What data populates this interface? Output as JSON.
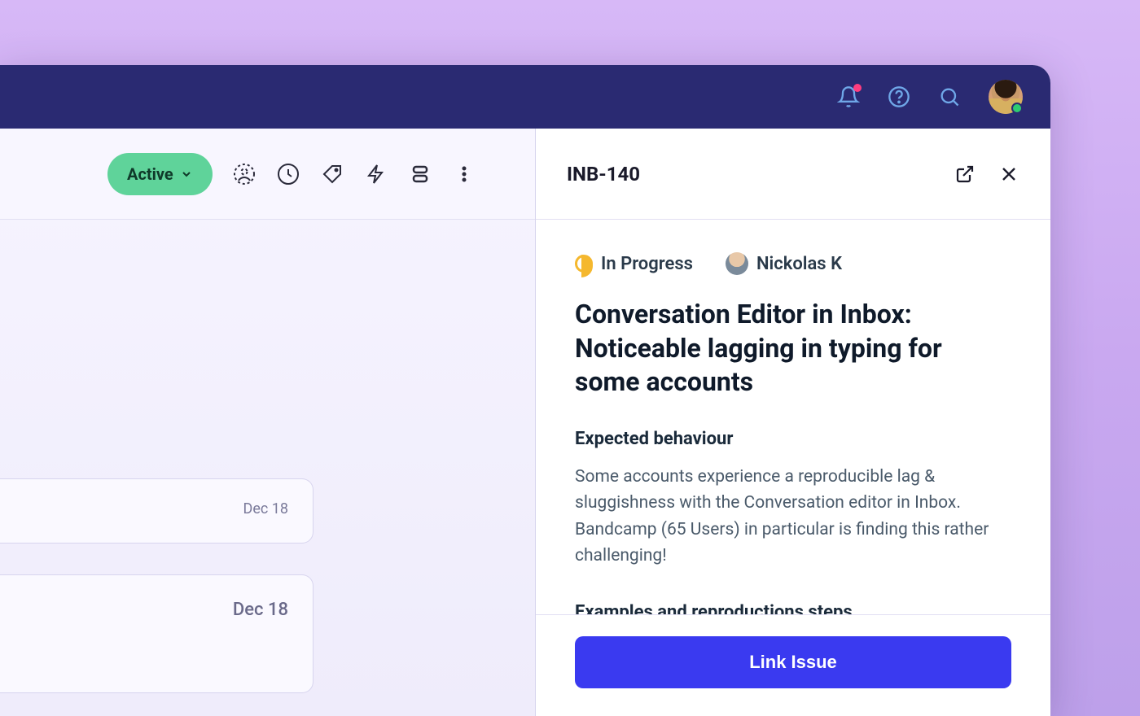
{
  "colors": {
    "nav_bg": "#2a2a72",
    "accent_green": "#5fd39a",
    "accent_blue": "#3a3af0",
    "status_amber": "#f5b82e"
  },
  "nav": {
    "notification_active": true,
    "presence": "online"
  },
  "toolbar": {
    "filter_chip": "Active"
  },
  "cards": [
    {
      "date": "Dec 18"
    },
    {
      "date": "Dec 18"
    }
  ],
  "panel": {
    "id": "INB-140",
    "status": "In Progress",
    "assignee": "Nickolas K",
    "title": "Conversation Editor in Inbox: Noticeable lagging in typing for some accounts",
    "section1_heading": "Expected behaviour",
    "section1_body": "Some accounts experience a reproducible lag & sluggishness with the Conversation editor in Inbox. Bandcamp (65 Users) in particular is finding this rather challenging!",
    "section2_heading": "Examples and reproductions steps",
    "primary_action": "Link Issue"
  }
}
